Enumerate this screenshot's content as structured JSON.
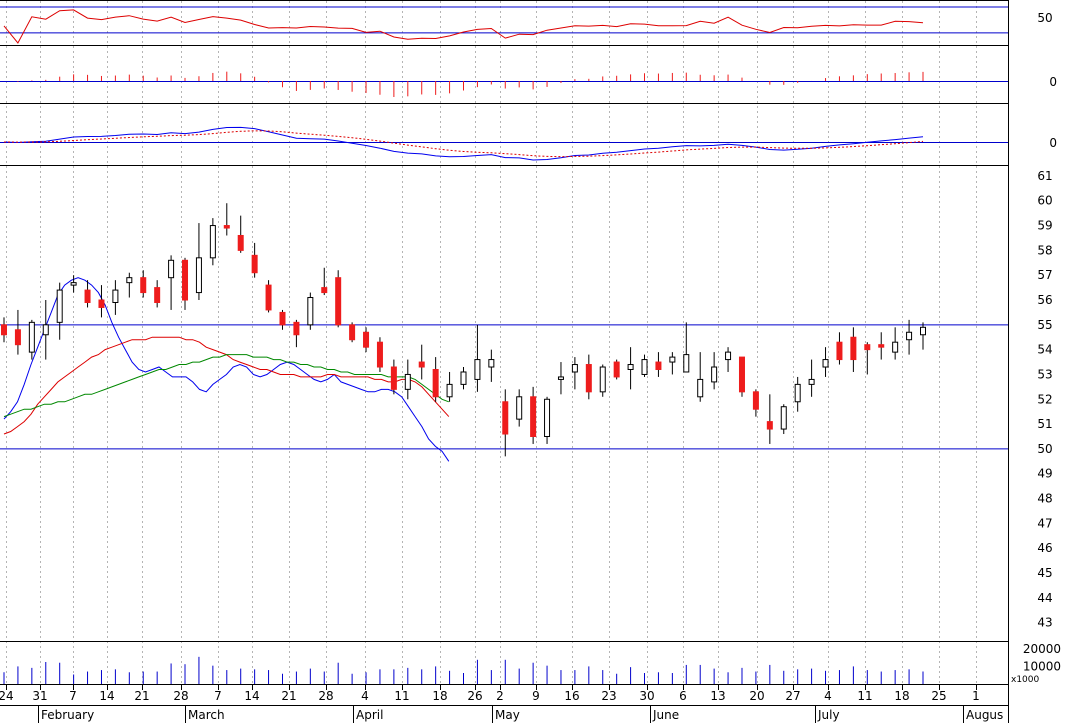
{
  "chart_data": {
    "type": "candlestick",
    "grid": true,
    "x_day_labels": [
      "24",
      "31",
      "7",
      "14",
      "21",
      "28",
      "7",
      "14",
      "21",
      "28",
      "4",
      "11",
      "18",
      "26",
      "2",
      "9",
      "16",
      "23",
      "30",
      "6",
      "13",
      "20",
      "27",
      "4",
      "11",
      "18",
      "25",
      "1"
    ],
    "x_month_labels": [
      "February",
      "March",
      "April",
      "May",
      "June",
      "July",
      "Augus"
    ],
    "volume_unit_label": "x1000",
    "panels": {
      "rsi": {
        "ticks": [
          "50"
        ],
        "reference_lines": [
          63,
          33
        ],
        "ylim": [
          20,
          70
        ]
      },
      "macd_histogram": {
        "ticks": [
          "0"
        ],
        "zero_line": 0
      },
      "macd": {
        "ticks": [
          "0"
        ],
        "zero_line": 0
      },
      "price": {
        "ticks": [
          "61",
          "60",
          "59",
          "58",
          "57",
          "56",
          "55",
          "54",
          "53",
          "52",
          "51",
          "50",
          "49",
          "48",
          "47",
          "46",
          "45",
          "44",
          "43"
        ],
        "ylim": [
          42.3,
          61.4
        ],
        "reference_lines": [
          55,
          50
        ]
      },
      "volume": {
        "ticks": [
          "20000",
          "10000"
        ],
        "ylim": [
          0,
          24000
        ]
      }
    },
    "colors": {
      "up": "#ffffff",
      "down": "#ee1c1c",
      "ma_short": "#0000ee",
      "ma_mid": "#dd0000",
      "ma_long": "#008800",
      "reference_line": "#0000cc",
      "volume": "#0000cc",
      "grid": "#b4b4b4"
    },
    "series": [
      {
        "name": "Short MA",
        "values": [
          51.2,
          51.5,
          51.9,
          52.6,
          53.4,
          54.1,
          54.8,
          55.5,
          56.2,
          56.6,
          56.8,
          56.9,
          56.8,
          56.6,
          56.3,
          55.8,
          55.1,
          54.5,
          54.0,
          53.5,
          53.2,
          53.1,
          53.2,
          53.3,
          53.1,
          52.9,
          52.9,
          52.9,
          52.7,
          52.4,
          52.3,
          52.6,
          52.8,
          53.0,
          53.3,
          53.4,
          53.3,
          53.0,
          52.9,
          53.0,
          53.2,
          53.4,
          53.5,
          53.4,
          53.2,
          53.0,
          52.8,
          52.7,
          52.8,
          53.0,
          52.7,
          52.6,
          52.5,
          52.4,
          52.3,
          52.3,
          52.4,
          52.4,
          52.3,
          52.1,
          51.7,
          51.3,
          50.9,
          50.4,
          50.1,
          49.9,
          49.5
        ]
      },
      {
        "name": "Mid MA",
        "values": [
          50.6,
          50.7,
          50.9,
          51.1,
          51.4,
          51.8,
          52.1,
          52.4,
          52.7,
          52.9,
          53.1,
          53.3,
          53.5,
          53.7,
          53.8,
          54.0,
          54.1,
          54.2,
          54.3,
          54.4,
          54.4,
          54.4,
          54.5,
          54.5,
          54.5,
          54.5,
          54.5,
          54.4,
          54.4,
          54.3,
          54.1,
          54.0,
          53.9,
          53.8,
          53.6,
          53.5,
          53.4,
          53.3,
          53.2,
          53.2,
          53.1,
          53.0,
          53.0,
          53.0,
          52.9,
          52.9,
          52.9,
          52.9,
          53.0,
          53.0,
          52.9,
          52.9,
          52.9,
          52.9,
          52.9,
          52.8,
          52.8,
          52.7,
          52.7,
          52.8,
          52.8,
          52.7,
          52.5,
          52.2,
          51.9,
          51.6,
          51.3
        ]
      },
      {
        "name": "Long MA",
        "values": [
          51.3,
          51.4,
          51.5,
          51.6,
          51.6,
          51.7,
          51.8,
          51.8,
          51.9,
          51.9,
          52.0,
          52.1,
          52.2,
          52.2,
          52.3,
          52.4,
          52.5,
          52.6,
          52.7,
          52.8,
          52.9,
          53.0,
          53.1,
          53.2,
          53.2,
          53.3,
          53.4,
          53.4,
          53.5,
          53.5,
          53.6,
          53.7,
          53.7,
          53.8,
          53.8,
          53.8,
          53.8,
          53.7,
          53.7,
          53.7,
          53.6,
          53.6,
          53.5,
          53.5,
          53.4,
          53.4,
          53.3,
          53.3,
          53.2,
          53.2,
          53.1,
          53.1,
          53.0,
          53.0,
          53.0,
          53.0,
          53.0,
          52.9,
          52.9,
          52.9,
          52.9,
          52.8,
          52.6,
          52.4,
          52.2,
          52.0,
          51.9
        ]
      }
    ],
    "candles": [
      {
        "o": 55.0,
        "h": 55.3,
        "l": 54.3,
        "c": 54.6
      },
      {
        "o": 54.8,
        "h": 55.6,
        "l": 53.8,
        "c": 54.2
      },
      {
        "o": 53.9,
        "h": 55.2,
        "l": 53.6,
        "c": 55.1
      },
      {
        "o": 54.6,
        "h": 56.0,
        "l": 53.6,
        "c": 55.0
      },
      {
        "o": 55.1,
        "h": 56.7,
        "l": 54.4,
        "c": 56.4
      },
      {
        "o": 56.6,
        "h": 57.0,
        "l": 56.3,
        "c": 56.7
      },
      {
        "o": 56.4,
        "h": 56.8,
        "l": 55.7,
        "c": 55.9
      },
      {
        "o": 56.0,
        "h": 56.6,
        "l": 55.3,
        "c": 55.7
      },
      {
        "o": 55.9,
        "h": 56.8,
        "l": 55.4,
        "c": 56.4
      },
      {
        "o": 56.7,
        "h": 57.1,
        "l": 56.1,
        "c": 56.9
      },
      {
        "o": 56.9,
        "h": 57.2,
        "l": 56.1,
        "c": 56.3
      },
      {
        "o": 56.5,
        "h": 56.8,
        "l": 55.7,
        "c": 55.9
      },
      {
        "o": 56.9,
        "h": 57.8,
        "l": 55.6,
        "c": 57.6
      },
      {
        "o": 57.6,
        "h": 57.7,
        "l": 55.6,
        "c": 56.0
      },
      {
        "o": 56.3,
        "h": 59.1,
        "l": 56.0,
        "c": 57.7
      },
      {
        "o": 57.7,
        "h": 59.3,
        "l": 57.4,
        "c": 59.0
      },
      {
        "o": 59.0,
        "h": 59.9,
        "l": 58.6,
        "c": 58.9
      },
      {
        "o": 58.6,
        "h": 59.4,
        "l": 57.9,
        "c": 58.0
      },
      {
        "o": 57.8,
        "h": 58.3,
        "l": 56.9,
        "c": 57.1
      },
      {
        "o": 56.6,
        "h": 56.8,
        "l": 55.5,
        "c": 55.6
      },
      {
        "o": 55.5,
        "h": 55.6,
        "l": 54.8,
        "c": 55.0
      },
      {
        "o": 55.1,
        "h": 55.2,
        "l": 54.1,
        "c": 54.6
      },
      {
        "o": 55.0,
        "h": 56.3,
        "l": 54.8,
        "c": 56.1
      },
      {
        "o": 56.5,
        "h": 57.3,
        "l": 56.2,
        "c": 56.3
      },
      {
        "o": 56.9,
        "h": 57.2,
        "l": 54.9,
        "c": 55.0
      },
      {
        "o": 55.0,
        "h": 55.1,
        "l": 54.3,
        "c": 54.4
      },
      {
        "o": 54.7,
        "h": 54.9,
        "l": 53.9,
        "c": 54.1
      },
      {
        "o": 54.3,
        "h": 54.5,
        "l": 53.1,
        "c": 53.3
      },
      {
        "o": 53.3,
        "h": 53.6,
        "l": 52.2,
        "c": 52.4
      },
      {
        "o": 52.4,
        "h": 53.6,
        "l": 52.0,
        "c": 53.0
      },
      {
        "o": 53.5,
        "h": 54.2,
        "l": 52.8,
        "c": 53.3
      },
      {
        "o": 53.2,
        "h": 53.7,
        "l": 51.9,
        "c": 52.1
      },
      {
        "o": 52.1,
        "h": 53.1,
        "l": 51.9,
        "c": 52.6
      },
      {
        "o": 52.6,
        "h": 53.3,
        "l": 52.4,
        "c": 53.1
      },
      {
        "o": 52.8,
        "h": 55.0,
        "l": 52.3,
        "c": 53.6
      },
      {
        "o": 53.3,
        "h": 54.0,
        "l": 52.7,
        "c": 53.6
      },
      {
        "o": 51.9,
        "h": 52.4,
        "l": 49.7,
        "c": 50.6
      },
      {
        "o": 51.2,
        "h": 52.4,
        "l": 50.9,
        "c": 52.1
      },
      {
        "o": 52.1,
        "h": 52.5,
        "l": 50.2,
        "c": 50.5
      },
      {
        "o": 50.5,
        "h": 52.1,
        "l": 50.2,
        "c": 52.0
      },
      {
        "o": 52.8,
        "h": 53.5,
        "l": 52.2,
        "c": 52.9
      },
      {
        "o": 53.1,
        "h": 53.7,
        "l": 52.4,
        "c": 53.4
      },
      {
        "o": 53.4,
        "h": 53.8,
        "l": 52.0,
        "c": 52.3
      },
      {
        "o": 52.3,
        "h": 53.4,
        "l": 52.1,
        "c": 53.3
      },
      {
        "o": 53.5,
        "h": 53.6,
        "l": 52.8,
        "c": 52.9
      },
      {
        "o": 53.2,
        "h": 54.1,
        "l": 52.4,
        "c": 53.4
      },
      {
        "o": 53.0,
        "h": 53.8,
        "l": 52.9,
        "c": 53.6
      },
      {
        "o": 53.5,
        "h": 53.9,
        "l": 52.9,
        "c": 53.2
      },
      {
        "o": 53.5,
        "h": 53.9,
        "l": 53.0,
        "c": 53.7
      },
      {
        "o": 53.1,
        "h": 55.1,
        "l": 53.1,
        "c": 53.8
      },
      {
        "o": 52.1,
        "h": 53.9,
        "l": 51.9,
        "c": 52.8
      },
      {
        "o": 52.7,
        "h": 53.9,
        "l": 52.4,
        "c": 53.3
      },
      {
        "o": 53.6,
        "h": 54.1,
        "l": 53.1,
        "c": 53.9
      },
      {
        "o": 53.7,
        "h": 53.7,
        "l": 52.1,
        "c": 52.3
      },
      {
        "o": 52.3,
        "h": 52.4,
        "l": 51.3,
        "c": 51.6
      },
      {
        "o": 51.1,
        "h": 52.2,
        "l": 50.2,
        "c": 50.8
      },
      {
        "o": 50.8,
        "h": 51.8,
        "l": 50.6,
        "c": 51.7
      },
      {
        "o": 51.9,
        "h": 52.9,
        "l": 51.5,
        "c": 52.6
      },
      {
        "o": 52.6,
        "h": 53.6,
        "l": 52.1,
        "c": 52.8
      },
      {
        "o": 53.3,
        "h": 54.1,
        "l": 52.9,
        "c": 53.6
      },
      {
        "o": 54.3,
        "h": 54.7,
        "l": 53.4,
        "c": 53.6
      },
      {
        "o": 54.5,
        "h": 54.9,
        "l": 53.1,
        "c": 53.6
      },
      {
        "o": 54.2,
        "h": 54.3,
        "l": 53.0,
        "c": 54.0
      },
      {
        "o": 54.2,
        "h": 54.7,
        "l": 53.6,
        "c": 54.1
      },
      {
        "o": 53.9,
        "h": 54.9,
        "l": 53.6,
        "c": 54.3
      },
      {
        "o": 54.4,
        "h": 55.2,
        "l": 53.8,
        "c": 54.7
      },
      {
        "o": 54.6,
        "h": 55.1,
        "l": 54.0,
        "c": 54.9
      }
    ]
  }
}
